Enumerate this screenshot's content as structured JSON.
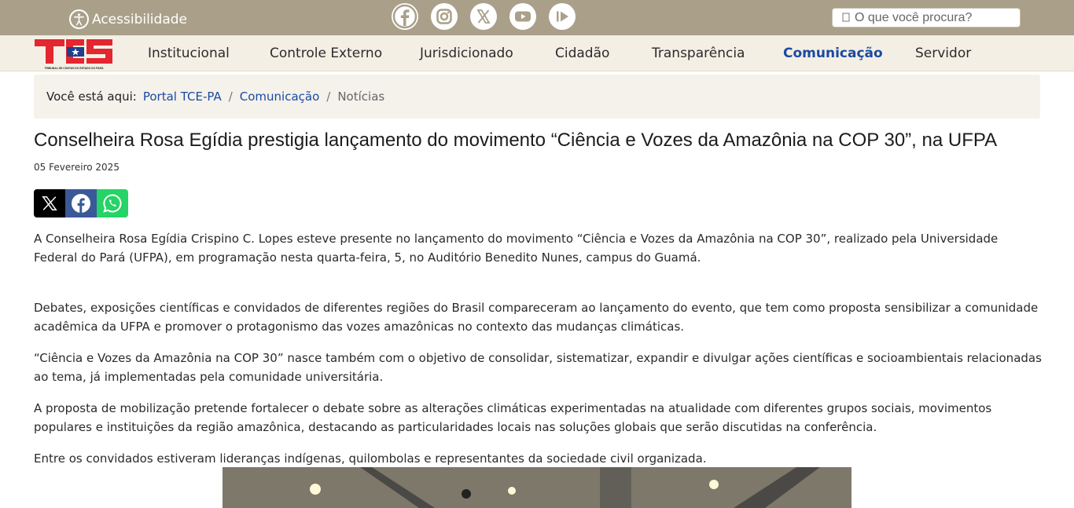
{
  "topbar": {
    "accessibility_label": "Acessibilidade",
    "social_icons": [
      "facebook-icon",
      "instagram-icon",
      "x-icon",
      "youtube-icon",
      "podcast-icon"
    ],
    "search_placeholder": "O que você procura?"
  },
  "logo": {
    "text": "TCE",
    "subtitle": "TRIBUNAL DE CONTAS DO ESTADO DO PARÁ"
  },
  "nav": {
    "items": [
      {
        "label": "Institucional"
      },
      {
        "label": "Controle Externo"
      },
      {
        "label": "Jurisdicionado"
      },
      {
        "label": "Cidadão"
      },
      {
        "label": "Transparência"
      },
      {
        "label": "Comunicação"
      },
      {
        "label": "Servidor"
      }
    ],
    "active": "Comunicação"
  },
  "breadcrumb": {
    "label": "Você está aqui:",
    "items": [
      "Portal TCE-PA",
      "Comunicação",
      "Notícias"
    ]
  },
  "article": {
    "title": "Conselheira Rosa Egídia prestigia lançamento do movimento “Ciência e Vozes da Amazônia na COP 30”, na UFPA",
    "date": "05 Fevereiro 2025",
    "paragraphs": [
      "A Conselheira Rosa Egídia Crispino C. Lopes esteve presente no lançamento do movimento “Ciência e Vozes da Amazônia na COP 30”, realizado pela Universidade Federal do Pará (UFPA), em programação nesta quarta-feira, 5, no Auditório Benedito Nunes, campus do Guamá.",
      "Debates, exposições científicas e convidados de diferentes regiões do Brasil compareceram ao lançamento do evento, que tem como proposta sensibilizar a comunidade acadêmica da UFPA e promover o protagonismo das vozes amazônicas no contexto das mudanças climáticas.",
      "“Ciência e Vozes da Amazônia na COP 30” nasce também com o objetivo de consolidar, sistematizar, expandir e divulgar ações científicas e socioambientais relacionadas ao tema, já implementadas pela comunidade universitária.",
      "A proposta de mobilização pretende fortalecer o debate sobre as alterações climáticas experimentadas na atualidade com diferentes grupos sociais, movimentos populares e instituições da região amazônica, destacando as particularidades locais nas soluções globais que serão discutidas na conferência.",
      "Entre os convidados estiveram lideranças indígenas, quilombolas e representantes da sociedade civil organizada."
    ]
  },
  "colors": {
    "topbar": "#aaa08a",
    "navbar": "#f4efe5",
    "accent": "#1a4aa0",
    "logo_red": "#e3262f"
  }
}
